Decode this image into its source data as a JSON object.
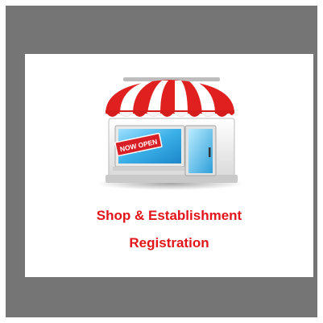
{
  "sign": {
    "text": "NOW OPEN"
  },
  "caption": {
    "line1": "Shop & Establishment",
    "line2": "Registration"
  },
  "colors": {
    "outer_gray": "#757575",
    "title_red": "#e3151a",
    "awning_red": "#e0201f",
    "glass_blue": "#39aee5"
  },
  "icons": {
    "illustration": "storefront-icon"
  }
}
